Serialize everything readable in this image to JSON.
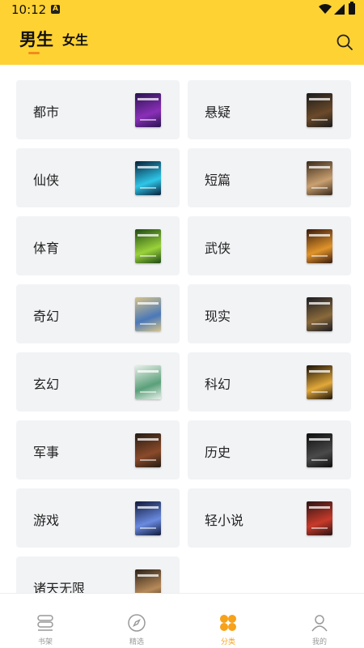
{
  "status_bar": {
    "time": "10:12",
    "notification_glyph": "A"
  },
  "header": {
    "background": "#FFD233",
    "accent": "#F08A1C",
    "tabs": [
      {
        "label": "男生",
        "active": true
      },
      {
        "label": "女生",
        "active": false
      }
    ],
    "search_icon": "search-icon"
  },
  "categories": [
    {
      "label": "都市",
      "cover": [
        "#2a1450",
        "#8a2fb8"
      ]
    },
    {
      "label": "悬疑",
      "cover": [
        "#1b1b1b",
        "#6b4a2a"
      ]
    },
    {
      "label": "仙侠",
      "cover": [
        "#07203a",
        "#2ec6e8"
      ]
    },
    {
      "label": "短篇",
      "cover": [
        "#3a2a1c",
        "#c9a070"
      ]
    },
    {
      "label": "体育",
      "cover": [
        "#1e4a14",
        "#9ad23a"
      ]
    },
    {
      "label": "武侠",
      "cover": [
        "#3a1a0e",
        "#e0942a"
      ]
    },
    {
      "label": "奇幻",
      "cover": [
        "#d6c48a",
        "#4a78b8"
      ]
    },
    {
      "label": "现实",
      "cover": [
        "#1c1c24",
        "#8a6a3a"
      ]
    },
    {
      "label": "玄幻",
      "cover": [
        "#e8f0ea",
        "#5aa07a"
      ]
    },
    {
      "label": "科幻",
      "cover": [
        "#1a1208",
        "#e2a83a"
      ]
    },
    {
      "label": "军事",
      "cover": [
        "#241c14",
        "#8a4a2a"
      ]
    },
    {
      "label": "历史",
      "cover": [
        "#0e0e0e",
        "#4a4a4a"
      ]
    },
    {
      "label": "游戏",
      "cover": [
        "#101a3a",
        "#6a8ae0"
      ]
    },
    {
      "label": "轻小说",
      "cover": [
        "#2a1414",
        "#c83a2a"
      ]
    },
    {
      "label": "诸天无限",
      "cover": [
        "#2a2218",
        "#b88a5a"
      ]
    }
  ],
  "bottom_nav": {
    "active_color": "#F7A21B",
    "items": [
      {
        "label": "书架",
        "icon": "bookshelf-icon",
        "active": false
      },
      {
        "label": "精选",
        "icon": "compass-icon",
        "active": false
      },
      {
        "label": "分类",
        "icon": "category-icon",
        "active": true
      },
      {
        "label": "我的",
        "icon": "profile-icon",
        "active": false
      }
    ]
  }
}
